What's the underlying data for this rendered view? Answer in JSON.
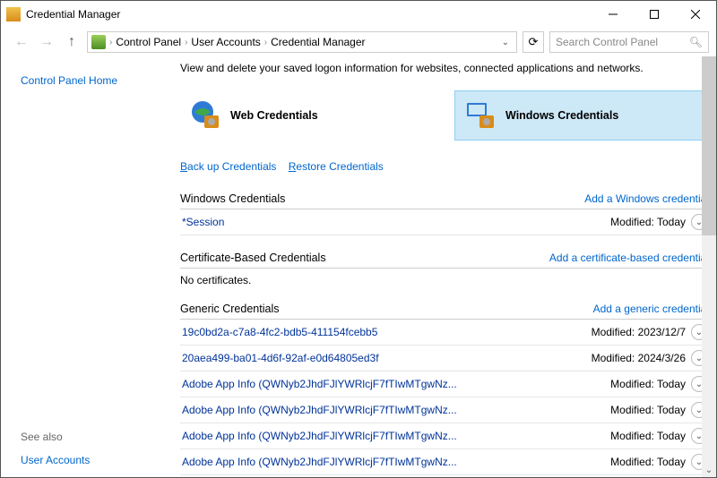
{
  "window": {
    "title": "Credential Manager"
  },
  "breadcrumb": {
    "parts": [
      "Control Panel",
      "User Accounts",
      "Credential Manager"
    ]
  },
  "search": {
    "placeholder": "Search Control Panel"
  },
  "sidebar": {
    "home": "Control Panel Home",
    "seealso": "See also",
    "useraccounts": "User Accounts"
  },
  "main": {
    "description": "View and delete your saved logon information for websites, connected applications and networks.",
    "tiles": {
      "web": "Web Credentials",
      "windows": "Windows Credentials"
    },
    "links": {
      "backup": "Back up Credentials",
      "restore": "Restore Credentials"
    },
    "sections": {
      "windows": {
        "title": "Windows Credentials",
        "add": "Add a Windows credential",
        "rows": [
          {
            "name": "*Session",
            "mod": "Modified: Today"
          }
        ]
      },
      "cert": {
        "title": "Certificate-Based Credentials",
        "add": "Add a certificate-based credential",
        "empty": "No certificates."
      },
      "generic": {
        "title": "Generic Credentials",
        "add": "Add a generic credential",
        "rows": [
          {
            "name": "19c0bd2a-c7a8-4fc2-bdb5-411154fcebb5",
            "mod": "Modified: 2023/12/7"
          },
          {
            "name": "20aea499-ba01-4d6f-92af-e0d64805ed3f",
            "mod": "Modified: 2024/3/26"
          },
          {
            "name": "Adobe App Info (QWNyb2JhdFJlYWRlcjF7fTIwMTgwNz...",
            "mod": "Modified: Today"
          },
          {
            "name": "Adobe App Info (QWNyb2JhdFJlYWRlcjF7fTIwMTgwNz...",
            "mod": "Modified: Today"
          },
          {
            "name": "Adobe App Info (QWNyb2JhdFJlYWRlcjF7fTIwMTgwNz...",
            "mod": "Modified: Today"
          },
          {
            "name": "Adobe App Info (QWNyb2JhdFJlYWRlcjF7fTIwMTgwNz...",
            "mod": "Modified: Today"
          }
        ]
      }
    }
  }
}
